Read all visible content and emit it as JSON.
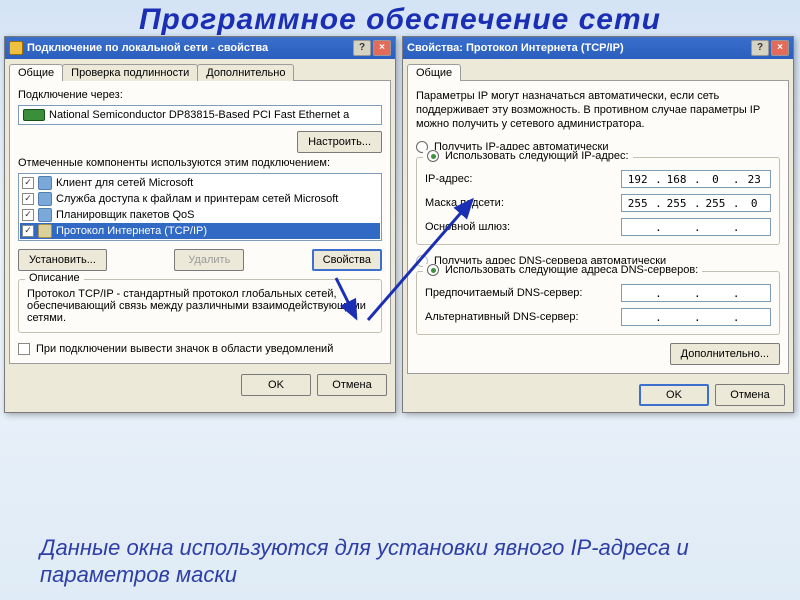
{
  "slide": {
    "title": "Программное обеспечение сети",
    "caption": "Данные окна используются для установки явного IP-адреса и параметров маски"
  },
  "dlg1": {
    "title": "Подключение по локальной сети - свойства",
    "tabs": {
      "t1": "Общие",
      "t2": "Проверка подлинности",
      "t3": "Дополнительно"
    },
    "connect_via": "Подключение через:",
    "adapter": "National Semiconductor DP83815-Based PCI Fast Ethernet a",
    "configure": "Настроить...",
    "components_label": "Отмеченные компоненты используются этим подключением:",
    "comp1": "Клиент для сетей Microsoft",
    "comp2": "Служба доступа к файлам и принтерам сетей Microsoft",
    "comp3": "Планировщик пакетов QoS",
    "comp4": "Протокол Интернета (TCP/IP)",
    "install": "Установить...",
    "remove": "Удалить",
    "props": "Свойства",
    "desc_title": "Описание",
    "desc": "Протокол TCP/IP - стандартный протокол глобальных сетей, обеспечивающий связь между различными взаимодействующими сетями.",
    "tray": "При подключении вывести значок в области уведомлений",
    "ok": "OK",
    "cancel": "Отмена"
  },
  "dlg2": {
    "title": "Свойства: Протокол Интернета (TCP/IP)",
    "tab": "Общие",
    "note": "Параметры IP могут назначаться автоматически, если сеть поддерживает эту возможность. В противном случае параметры IP можно получить у сетевого администратора.",
    "r_ip_auto": "Получить IP-адрес автоматически",
    "r_ip_man": "Использовать следующий IP-адрес:",
    "lbl_ip": "IP-адрес:",
    "lbl_mask": "Маска подсети:",
    "lbl_gw": "Основной шлюз:",
    "ip": {
      "a": "192",
      "b": "168",
      "c": "0",
      "d": "23"
    },
    "mask": {
      "a": "255",
      "b": "255",
      "c": "255",
      "d": "0"
    },
    "gw": {
      "a": "",
      "b": "",
      "c": "",
      "d": ""
    },
    "r_dns_auto": "Получить адрес DNS-сервера автоматически",
    "r_dns_man": "Использовать следующие адреса DNS-серверов:",
    "lbl_dns1": "Предпочитаемый DNS-сервер:",
    "lbl_dns2": "Альтернативный DNS-сервер:",
    "advanced": "Дополнительно...",
    "ok": "OK",
    "cancel": "Отмена"
  }
}
